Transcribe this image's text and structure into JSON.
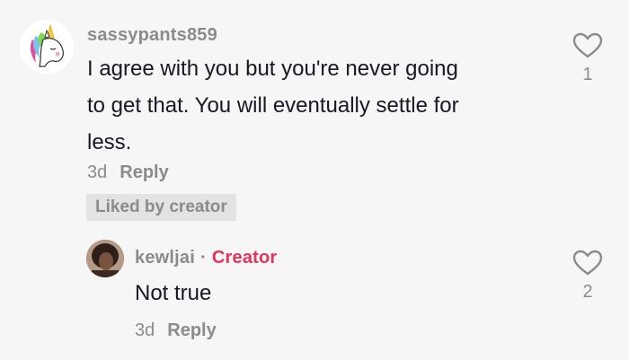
{
  "comments": [
    {
      "username": "sassypants859",
      "text_lines": [
        "I agree with you but you're never going",
        "to get that. You will eventually settle for",
        "less."
      ],
      "time": "3d",
      "reply_label": "Reply",
      "liked_badge": "Liked by creator",
      "likes": "1"
    },
    {
      "username": "kewljai",
      "separator": "·",
      "creator_label": "Creator",
      "text": "Not true",
      "time": "3d",
      "reply_label": "Reply",
      "likes": "2"
    }
  ],
  "colors": {
    "creator": "#e2335a",
    "muted": "#8b8b8f",
    "text": "#161823",
    "background": "#f6f6f6"
  },
  "icons": {
    "like": "heart-outline-icon",
    "avatar_main": "unicorn-avatar",
    "avatar_reply": "user-photo-avatar"
  }
}
